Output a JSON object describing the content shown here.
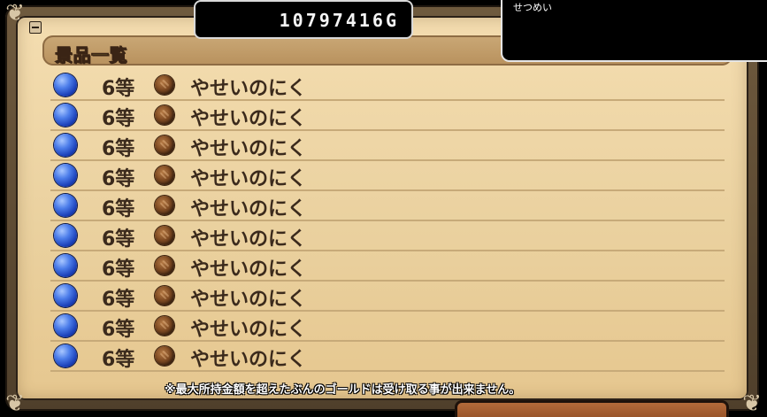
{
  "gold": {
    "amount": "10797416G"
  },
  "description": {
    "label": "せつめい"
  },
  "prize_list": {
    "title": "景品一覧",
    "items": [
      {
        "rank": "6等",
        "name": "やせいのにく",
        "orb_icon": "blue-orb-icon",
        "item_icon": "meat-icon"
      },
      {
        "rank": "6等",
        "name": "やせいのにく",
        "orb_icon": "blue-orb-icon",
        "item_icon": "meat-icon"
      },
      {
        "rank": "6等",
        "name": "やせいのにく",
        "orb_icon": "blue-orb-icon",
        "item_icon": "meat-icon"
      },
      {
        "rank": "6等",
        "name": "やせいのにく",
        "orb_icon": "blue-orb-icon",
        "item_icon": "meat-icon"
      },
      {
        "rank": "6等",
        "name": "やせいのにく",
        "orb_icon": "blue-orb-icon",
        "item_icon": "meat-icon"
      },
      {
        "rank": "6等",
        "name": "やせいのにく",
        "orb_icon": "blue-orb-icon",
        "item_icon": "meat-icon"
      },
      {
        "rank": "6等",
        "name": "やせいのにく",
        "orb_icon": "blue-orb-icon",
        "item_icon": "meat-icon"
      },
      {
        "rank": "6等",
        "name": "やせいのにく",
        "orb_icon": "blue-orb-icon",
        "item_icon": "meat-icon"
      },
      {
        "rank": "6等",
        "name": "やせいのにく",
        "orb_icon": "blue-orb-icon",
        "item_icon": "meat-icon"
      },
      {
        "rank": "6等",
        "name": "やせいのにく",
        "orb_icon": "blue-orb-icon",
        "item_icon": "meat-icon"
      }
    ]
  },
  "note": "※最大所持金額を超えたぶんのゴールドは受け取る事が出来ません。",
  "colors": {
    "parchment": "#ead19f",
    "title_yellow": "#fff36a",
    "text_brown": "#3b2a1c",
    "orb_blue": "#4d7eea"
  }
}
